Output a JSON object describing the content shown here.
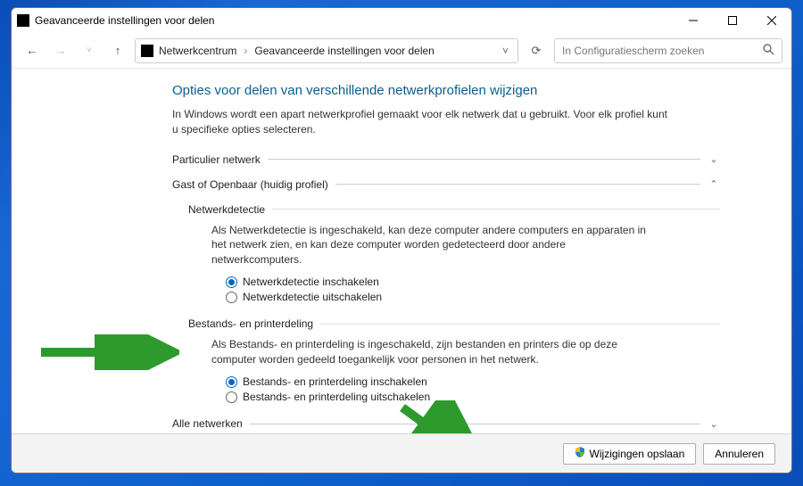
{
  "window": {
    "title": "Geavanceerde instellingen voor delen"
  },
  "breadcrumb": {
    "part1": "Netwerkcentrum",
    "part2": "Geavanceerde instellingen voor delen"
  },
  "search": {
    "placeholder": "In Configuratiescherm zoeken"
  },
  "main": {
    "heading": "Opties voor delen van verschillende netwerkprofielen wijzigen",
    "intro": "In Windows wordt een apart netwerkprofiel gemaakt voor elk netwerk dat u gebruikt. Voor elk profiel kunt u specifieke opties selecteren.",
    "profile_private": "Particulier netwerk",
    "profile_guest": "Gast of Openbaar (huidig profiel)",
    "profile_all": "Alle netwerken",
    "nd": {
      "subhead": "Netwerkdetectie",
      "desc": "Als Netwerkdetectie is ingeschakeld, kan deze computer andere computers en apparaten in het netwerk zien, en kan deze computer worden gedetecteerd door andere netwerkcomputers.",
      "on": "Netwerkdetectie inschakelen",
      "off": "Netwerkdetectie uitschakelen"
    },
    "fp": {
      "subhead": "Bestands- en printerdeling",
      "desc": "Als Bestands- en printerdeling is ingeschakeld, zijn bestanden en printers die op deze computer worden gedeeld toegankelijk voor personen in het netwerk.",
      "on": "Bestands- en printerdeling inschakelen",
      "off": "Bestands- en printerdeling uitschakelen"
    }
  },
  "footer": {
    "save": "Wijzigingen opslaan",
    "cancel": "Annuleren"
  }
}
